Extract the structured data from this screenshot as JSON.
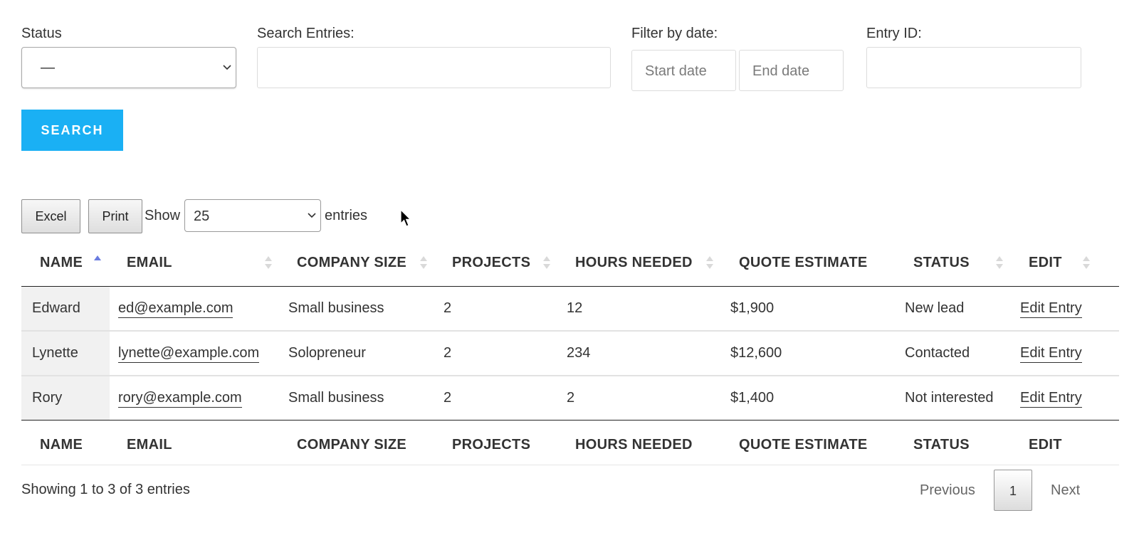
{
  "filters": {
    "status_label": "Status",
    "status_value": "—",
    "search_label": "Search Entries:",
    "search_value": "",
    "date_label": "Filter by date:",
    "start_placeholder": "Start date",
    "end_placeholder": "End date",
    "entry_id_label": "Entry ID:",
    "entry_id_value": "",
    "search_button": "SEARCH"
  },
  "toolbar": {
    "excel": "Excel",
    "print": "Print",
    "show": "Show",
    "page_size": "25",
    "entries": "entries"
  },
  "table": {
    "columns": [
      "NAME",
      "EMAIL",
      "COMPANY SIZE",
      "PROJECTS",
      "HOURS NEEDED",
      "QUOTE ESTIMATE",
      "STATUS",
      "EDIT"
    ],
    "rows": [
      [
        "Edward",
        "ed@example.com",
        "Small business",
        "2",
        "12",
        "$1,900",
        "New lead",
        "Edit Entry"
      ],
      [
        "Lynette",
        "lynette@example.com",
        "Solopreneur",
        "2",
        "234",
        "$12,600",
        "Contacted",
        "Edit Entry"
      ],
      [
        "Rory",
        "rory@example.com",
        "Small business",
        "2",
        "2",
        "$1,400",
        "Not interested",
        "Edit Entry"
      ]
    ],
    "sorted_column": "NAME",
    "sort_direction": "ascending"
  },
  "footer": {
    "info": "Showing 1 to 3 of 3 entries",
    "previous": "Previous",
    "current_page": "1",
    "next": "Next"
  },
  "colors": {
    "accent": "#1ab0f4",
    "sort_active": "#6a7ce0"
  }
}
